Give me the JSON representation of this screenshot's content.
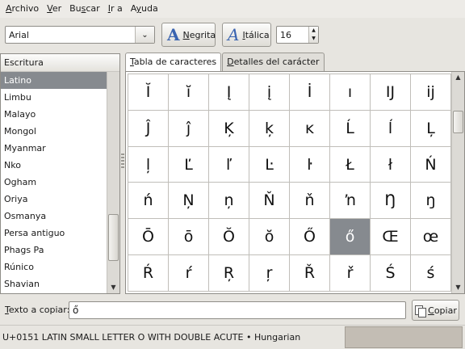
{
  "menubar": {
    "items": [
      {
        "pre": "",
        "key": "A",
        "post": "rchivo"
      },
      {
        "pre": "",
        "key": "V",
        "post": "er"
      },
      {
        "pre": "Bu",
        "key": "s",
        "post": "car"
      },
      {
        "pre": "",
        "key": "I",
        "post": "r a"
      },
      {
        "pre": "A",
        "key": "y",
        "post": "uda"
      }
    ]
  },
  "toolbar": {
    "font": "Arial",
    "bold": {
      "glyph": "A",
      "pre": "",
      "key": "N",
      "post": "egrita"
    },
    "italic": {
      "glyph": "A",
      "pre": "",
      "key": "I",
      "post": "tálica"
    },
    "size": "16"
  },
  "scripts": {
    "header": "Escritura",
    "items": [
      "Latino",
      "Limbu",
      "Malayo",
      "Mongol",
      "Myanmar",
      "Nko",
      "Ogham",
      "Oriya",
      "Osmanya",
      "Persa antiguo",
      "Phags Pa",
      "Rúnico",
      "Shavian"
    ],
    "selected": "Latino"
  },
  "tabs": [
    {
      "pre": "",
      "key": "T",
      "post": "abla de caracteres"
    },
    {
      "pre": "",
      "key": "D",
      "post": "etalles del carácter"
    }
  ],
  "chars": [
    [
      "Ĭ",
      "ĭ",
      "Į",
      "į",
      "İ",
      "ı",
      "Ĳ",
      "ĳ"
    ],
    [
      "Ĵ",
      "ĵ",
      "Ķ",
      "ķ",
      "ĸ",
      "Ĺ",
      "ĺ",
      "Ļ"
    ],
    [
      "ļ",
      "Ľ",
      "ľ",
      "Ŀ",
      "ŀ",
      "Ł",
      "ł",
      "Ń"
    ],
    [
      "ń",
      "Ņ",
      "ņ",
      "Ň",
      "ň",
      "ŉ",
      "Ŋ",
      "ŋ"
    ],
    [
      "Ō",
      "ō",
      "Ŏ",
      "ŏ",
      "Ő",
      "ő",
      "Œ",
      "œ"
    ],
    [
      "Ŕ",
      "ŕ",
      "Ŗ",
      "ŗ",
      "Ř",
      "ř",
      "Ś",
      "ś"
    ]
  ],
  "selected_char": "ő",
  "copy": {
    "label_pre": "",
    "label_key": "T",
    "label_post": "exto a copiar:",
    "value": "ő",
    "button_pre": "",
    "button_key": "C",
    "button_post": "opiar"
  },
  "status": "U+0151 LATIN SMALL LETTER O WITH DOUBLE ACUTE  • Hungarian"
}
